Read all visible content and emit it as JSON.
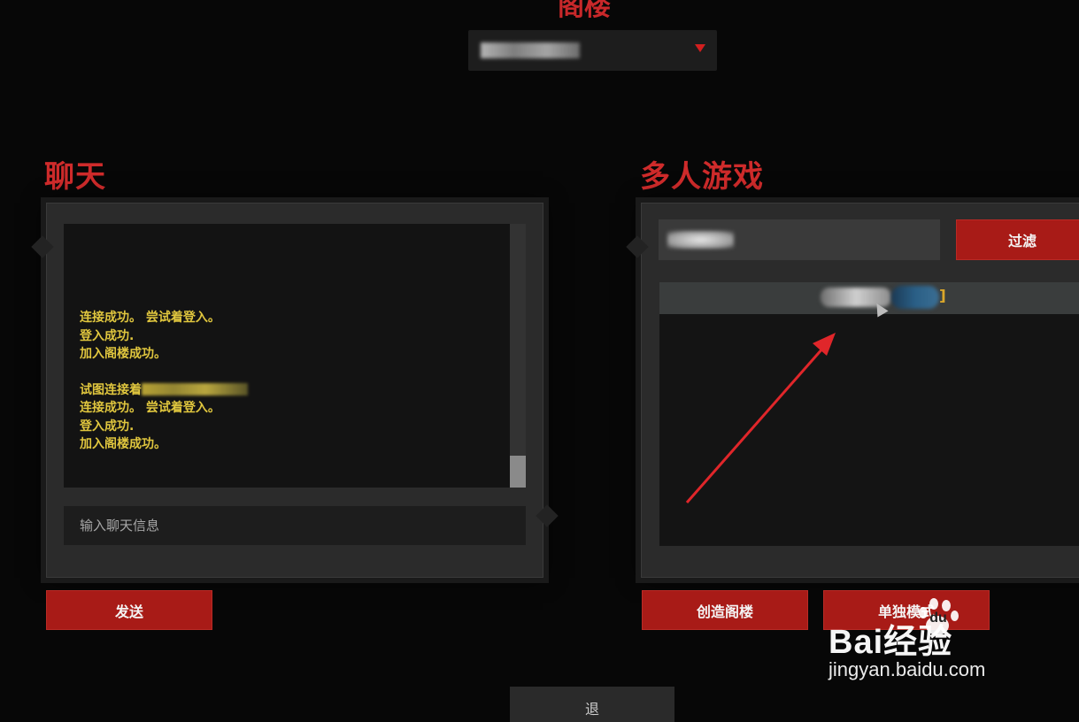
{
  "header": {
    "title": "阁楼",
    "dropdown_selected_blurred": true,
    "dropdown_caret_icon": "caret-down-icon"
  },
  "chat": {
    "title": "聊天",
    "log": [
      "连接成功。 尝试着登入。",
      "登入成功.",
      "加入阁楼成功。",
      "",
      "试图连接着",
      "连接成功。 尝试着登入。",
      "登入成功.",
      "加入阁楼成功。"
    ],
    "input_placeholder": "输入聊天信息",
    "send_label": "发送"
  },
  "multiplayer": {
    "title": "多人游戏",
    "filter_label": "过滤",
    "lobby_rows": [
      {
        "name_blurred": true,
        "bracket": "]"
      }
    ],
    "create_label": "创造阁楼",
    "single_label": "单独模式"
  },
  "footer": {
    "exit_label": "退"
  },
  "watermark": {
    "brand": "Bai经验",
    "brand_du": "du",
    "url": "jingyan.baidu.com"
  },
  "colors": {
    "accent_red": "#a81b17",
    "title_red": "#cf2b2b",
    "chat_text": "#e0c63e",
    "background": "#070707"
  }
}
